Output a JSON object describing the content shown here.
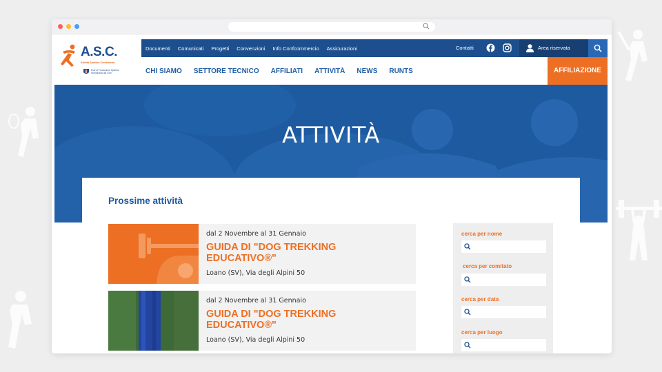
{
  "browser": {
    "address_icon": "search-icon"
  },
  "site": {
    "logo": {
      "name": "A.S.C.",
      "tagline": "Attività Sportive Confederate",
      "coni_text": "Ente di Promozione Sportiva riconosciuto dal Coni"
    },
    "top_links": [
      "Documenti",
      "Comunicati",
      "Progetti",
      "Convenzioni",
      "Info Confcommercio",
      "Assicurazioni"
    ],
    "contatti": "Contatti",
    "reserved_area": "Area riservata",
    "main_nav": [
      "CHI SIAMO",
      "SETTORE TECNICO",
      "AFFILIATI",
      "ATTIVITÀ",
      "NEWS",
      "RUNTS"
    ],
    "cta": "AFFILIAZIONE"
  },
  "hero": {
    "title": "ATTIVITÀ"
  },
  "activities": {
    "section_title": "Prossime attività",
    "items": [
      {
        "date": "dal 2 Novembre al 31 Gennaio",
        "title": "GUIDA DI \"DOG TREKKING EDUCATIVO®\"",
        "place": "Loano (SV), Via degli Alpini 50"
      },
      {
        "date": "dal 2 Novembre al 31 Gennaio",
        "title": "GUIDA DI \"DOG TREKKING EDUCATIVO®\"",
        "place": "Loano (SV), Via degli Alpini 50"
      }
    ]
  },
  "filters": [
    {
      "label": "cerca per nome"
    },
    {
      "label": "cerca per comitato"
    },
    {
      "label": "cerca per data"
    },
    {
      "label": "cerca per luogo"
    }
  ],
  "colors": {
    "primary_blue": "#1d4f8e",
    "accent_orange": "#ec6f24",
    "hero_blue": "#1d5aa0"
  }
}
